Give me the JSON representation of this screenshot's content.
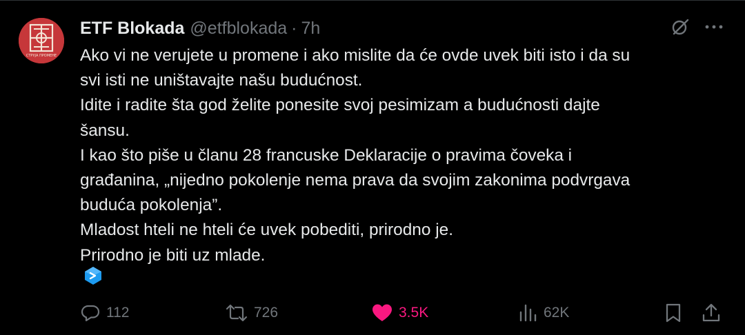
{
  "author": {
    "display_name": "ETF Blokada",
    "handle": "@etfblokada",
    "separator": "·",
    "time": "7h",
    "avatar_caption": "СТРУЈА ПРОМЕНЕ"
  },
  "tweet": {
    "lines": [
      "Ako vi ne verujete u promene i ako mislite da će ovde uvek biti isto i da su",
      "svi isti ne uništavajte našu budućnost.",
      "Idite i radite šta god želite ponesite svoj pesimizam a budućnosti dajte",
      "šansu.",
      "I kao što piše u članu 28 francuske Deklaracije o pravima čoveka i",
      "građanina, „nijedno pokolenje nema prava da svojim zakonima podvrgava",
      "buduća pokolenja”.",
      "Mladost hteli ne hteli će uvek pobediti, prirodno je.",
      "Prirodno je biti uz mlade."
    ]
  },
  "actions": {
    "replies": "112",
    "reposts": "726",
    "likes": "3.5K",
    "views": "62K"
  },
  "icons": {
    "grok": "grok-icon",
    "more": "more-icon",
    "translate": "translate-badge-icon",
    "reply": "reply-icon",
    "repost": "repost-icon",
    "like": "heart-icon",
    "views": "views-icon",
    "bookmark": "bookmark-icon",
    "share": "share-icon"
  },
  "colors": {
    "background": "#000000",
    "text": "#e7e9ea",
    "muted": "#71767b",
    "like": "#f91880",
    "avatar": "#c6373a",
    "badge": "#1d9bf0"
  }
}
